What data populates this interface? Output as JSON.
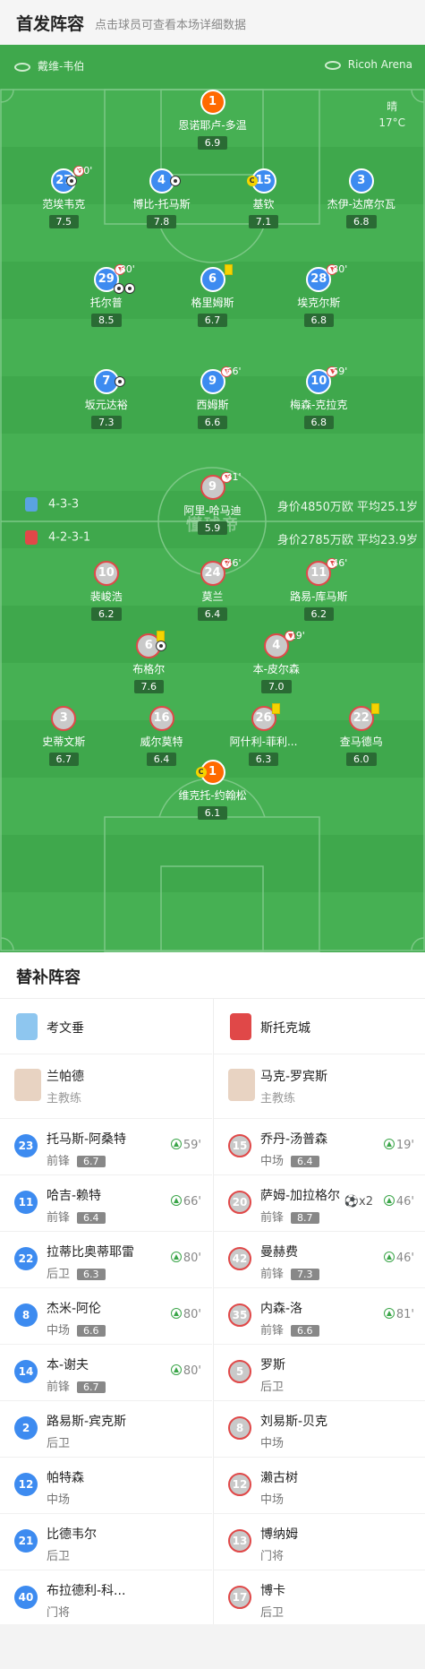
{
  "header": {
    "title": "首发阵容",
    "hint": "点击球员可查看本场详细数据"
  },
  "venue": {
    "referee": "戴维-韦伯",
    "stadium": "Ricoh Arena",
    "weather": "晴",
    "temp": "17°C"
  },
  "watermark": "懂球帝",
  "home": {
    "formation": "4-3-3",
    "worth": "身价4850万欧  平均25.1岁",
    "color": "#3d8bf0",
    "players": [
      {
        "num": "1",
        "name": "恩诺耶卢-多温",
        "rating": "6.9"
      },
      {
        "num": "27",
        "name": "范埃韦克",
        "rating": "7.5",
        "mk": "80'"
      },
      {
        "num": "4",
        "name": "博比-托马斯",
        "rating": "7.8"
      },
      {
        "num": "15",
        "name": "基钦",
        "rating": "7.1"
      },
      {
        "num": "3",
        "name": "杰伊-达席尔瓦",
        "rating": "6.8"
      },
      {
        "num": "29",
        "name": "托尔普",
        "rating": "8.5",
        "mk": "80'"
      },
      {
        "num": "6",
        "name": "格里姆斯",
        "rating": "6.7"
      },
      {
        "num": "28",
        "name": "埃克尔斯",
        "rating": "6.8",
        "mk": "80'"
      },
      {
        "num": "7",
        "name": "坂元达裕",
        "rating": "7.3"
      },
      {
        "num": "9",
        "name": "西姆斯",
        "rating": "6.6",
        "mk": "66'"
      },
      {
        "num": "10",
        "name": "梅森-克拉克",
        "rating": "6.8",
        "mk": "59'"
      }
    ]
  },
  "away": {
    "formation": "4-2-3-1",
    "worth": "身价2785万欧  平均23.9岁",
    "color": "#e04848",
    "players": [
      {
        "num": "9",
        "name": "阿里-哈马迪",
        "rating": "5.9",
        "mk": "81'"
      },
      {
        "num": "10",
        "name": "裴峻浩",
        "rating": "6.2"
      },
      {
        "num": "24",
        "name": "莫兰",
        "rating": "6.4",
        "mk": "46'"
      },
      {
        "num": "11",
        "name": "路易-库马斯",
        "rating": "6.2",
        "mk": "46'"
      },
      {
        "num": "6",
        "name": "布格尔",
        "rating": "7.6"
      },
      {
        "num": "4",
        "name": "本-皮尔森",
        "rating": "7.0",
        "mk": "19'"
      },
      {
        "num": "3",
        "name": "史蒂文斯",
        "rating": "6.7"
      },
      {
        "num": "16",
        "name": "威尔莫特",
        "rating": "6.4"
      },
      {
        "num": "26",
        "name": "阿什利-菲利...",
        "rating": "6.3"
      },
      {
        "num": "22",
        "name": "查马德乌",
        "rating": "6.0"
      },
      {
        "num": "1",
        "name": "维克托-约翰松",
        "rating": "6.1"
      }
    ]
  },
  "subs": {
    "title": "替补阵容",
    "home": {
      "team": "考文垂",
      "coach": "兰帕德",
      "coach_role": "主教练",
      "rows": [
        {
          "num": "23",
          "name": "托马斯-阿桑特",
          "pos": "前锋",
          "rating": "6.7",
          "min": "59'"
        },
        {
          "num": "11",
          "name": "哈吉-赖特",
          "pos": "前锋",
          "rating": "6.4",
          "min": "66'"
        },
        {
          "num": "22",
          "name": "拉蒂比奥蒂耶雷",
          "pos": "后卫",
          "rating": "6.3",
          "min": "80'"
        },
        {
          "num": "8",
          "name": "杰米-阿伦",
          "pos": "中场",
          "rating": "6.6",
          "min": "80'"
        },
        {
          "num": "14",
          "name": "本-谢夫",
          "pos": "前锋",
          "rating": "6.7",
          "min": "80'"
        },
        {
          "num": "2",
          "name": "路易斯-宾克斯",
          "pos": "后卫"
        },
        {
          "num": "12",
          "name": "帕特森",
          "pos": "中场"
        },
        {
          "num": "21",
          "name": "比德韦尔",
          "pos": "后卫"
        },
        {
          "num": "40",
          "name": "布拉德利-科...",
          "pos": "门将"
        }
      ]
    },
    "away": {
      "team": "斯托克城",
      "coach": "马克-罗宾斯",
      "coach_role": "主教练",
      "rows": [
        {
          "num": "15",
          "name": "乔丹-汤普森",
          "pos": "中场",
          "rating": "6.4",
          "min": "19'"
        },
        {
          "num": "20",
          "name": "萨姆-加拉格尔",
          "pos": "前锋",
          "rating": "8.7",
          "min": "46'",
          "goals": "x2"
        },
        {
          "num": "42",
          "name": "曼赫费",
          "pos": "前锋",
          "rating": "7.3",
          "min": "46'"
        },
        {
          "num": "35",
          "name": "内森-洛",
          "pos": "前锋",
          "rating": "6.6",
          "min": "81'"
        },
        {
          "num": "5",
          "name": "罗斯",
          "pos": "后卫"
        },
        {
          "num": "8",
          "name": "刘易斯-贝克",
          "pos": "中场"
        },
        {
          "num": "12",
          "name": "濑古树",
          "pos": "中场"
        },
        {
          "num": "13",
          "name": "博纳姆",
          "pos": "门将"
        },
        {
          "num": "17",
          "name": "博卡",
          "pos": "后卫"
        }
      ]
    }
  }
}
